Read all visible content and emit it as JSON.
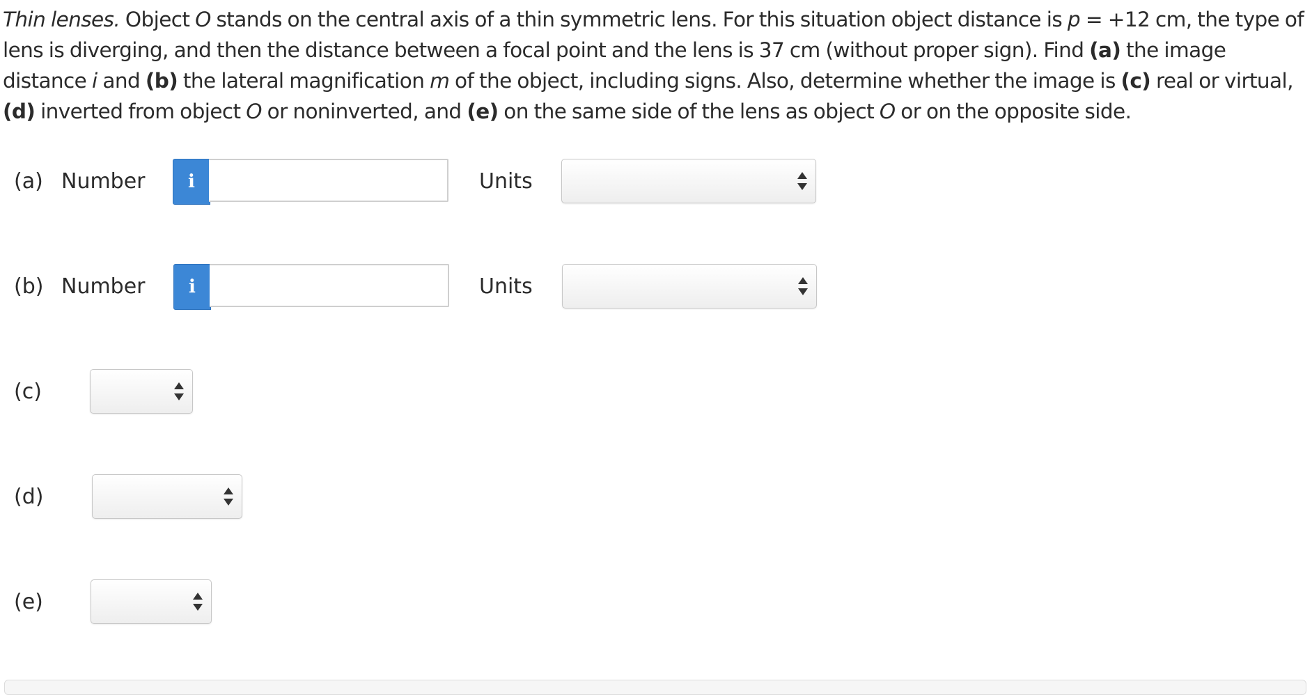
{
  "problem": {
    "title": "Thin lenses.",
    "s1": " Object ",
    "O1": "O",
    "s2": " stands on the central axis of a thin symmetric lens. For this situation object distance is ",
    "p": "p",
    "s3": " = +12 cm, the type of lens is diverging, and then the distance between a focal point and the lens is 37 cm (without proper sign). Find ",
    "a": "(a)",
    "s4": " the image distance ",
    "i": "i",
    "s5": " and ",
    "b": "(b)",
    "s6": " the lateral magnification ",
    "m": "m",
    "s7": " of the object, including signs. Also, determine whether the image is ",
    "c": "(c)",
    "s8": " real or virtual, ",
    "d": "(d)",
    "s9": " inverted from object ",
    "O2": "O",
    "s10": " or noninverted, and ",
    "e": "(e)",
    "s11": " on the same side of the lens as object ",
    "O3": "O",
    "s12": " or on the opposite side."
  },
  "parts": {
    "a": {
      "label": "(a)",
      "number_label": "Number",
      "info": "i",
      "value": "",
      "units_label": "Units",
      "units_value": ""
    },
    "b": {
      "label": "(b)",
      "number_label": "Number",
      "info": "i",
      "value": "",
      "units_label": "Units",
      "units_value": ""
    },
    "c": {
      "label": "(c)",
      "value": ""
    },
    "d": {
      "label": "(d)",
      "value": ""
    },
    "e": {
      "label": "(e)",
      "value": ""
    }
  },
  "icons": {
    "info": "info-icon",
    "select_arrows": "up-down-arrows-icon"
  },
  "colors": {
    "info_button": "#3c87d6",
    "text": "#2b2b2b"
  }
}
